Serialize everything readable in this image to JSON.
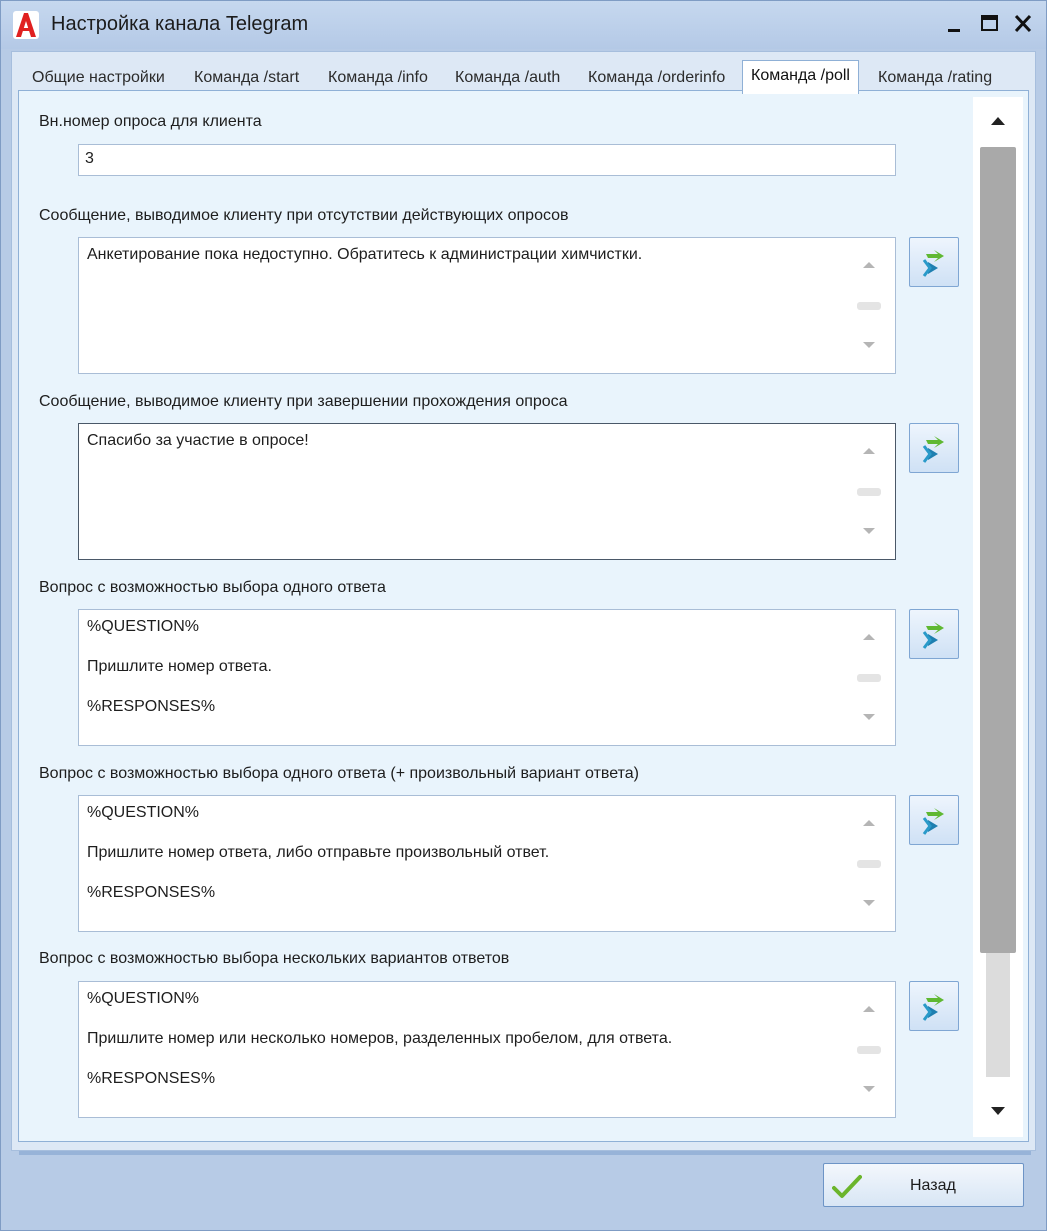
{
  "window": {
    "title": "Настройка канала Telegram"
  },
  "tabs": [
    {
      "label": "Общие настройки",
      "active": false
    },
    {
      "label": "Команда /start",
      "active": false
    },
    {
      "label": "Команда /info",
      "active": false
    },
    {
      "label": "Команда /auth",
      "active": false
    },
    {
      "label": "Команда /orderinfo",
      "active": false
    },
    {
      "label": "Команда /poll",
      "active": true
    },
    {
      "label": "Команда /rating",
      "active": false
    }
  ],
  "fields": {
    "poll_number": {
      "label": "Вн.номер опроса для клиента",
      "value": "3"
    },
    "no_polls_message": {
      "label": "Сообщение, выводимое клиенту при отсутствии действующих опросов",
      "lines": [
        "Анкетирование пока недоступно. Обратитесь к администрации химчистки."
      ]
    },
    "poll_complete_message": {
      "label": "Сообщение, выводимое клиенту при завершении прохождения опроса",
      "lines": [
        "Спасибо за участие в опросе!"
      ]
    },
    "single_choice": {
      "label": "Вопрос с возможностью выбора одного ответа",
      "lines": [
        "%QUESTION%",
        "Пришлите номер ответа.",
        "%RESPONSES%"
      ]
    },
    "single_choice_custom": {
      "label": "Вопрос с возможностью выбора одного ответа (+ произвольный вариант ответа)",
      "lines": [
        "%QUESTION%",
        "Пришлите номер ответа, либо отправьте произвольный ответ.",
        "%RESPONSES%"
      ]
    },
    "multi_choice": {
      "label": "Вопрос с возможностью выбора нескольких вариантов ответов",
      "lines": [
        "%QUESTION%",
        "Пришлите номер или несколько номеров, разделенных пробелом, для ответа.",
        "%RESPONSES%"
      ]
    }
  },
  "buttons": {
    "back": "Назад"
  },
  "colors": {
    "titlebar": "#b4c9e6",
    "tab_page": "#e9f4fc",
    "accent_border": "#7fa6d3",
    "check_green": "#6bb52c"
  }
}
